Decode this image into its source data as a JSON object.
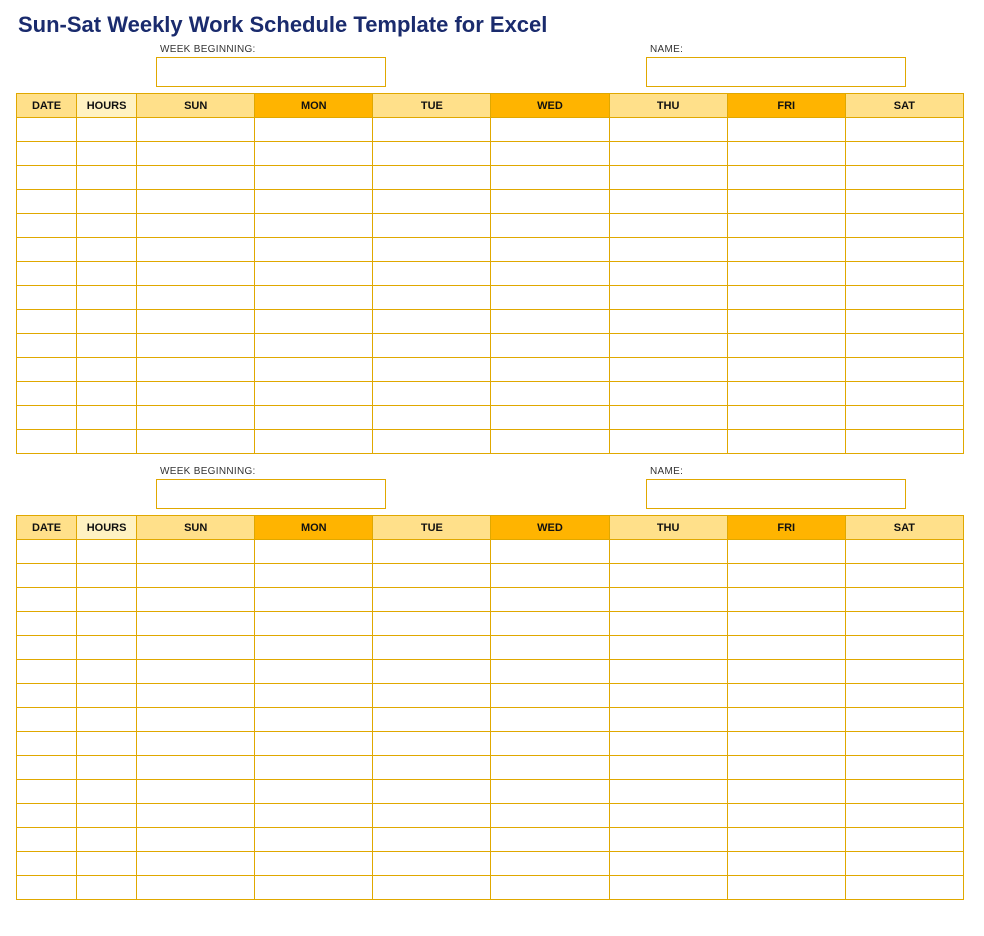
{
  "title": "Sun-Sat Weekly Work Schedule Template for Excel",
  "labels": {
    "week_beginning": "WEEK BEGINNING:",
    "name": "NAME:"
  },
  "columns": {
    "date": "DATE",
    "hours": "HOURS",
    "days": [
      "SUN",
      "MON",
      "TUE",
      "WED",
      "THU",
      "FRI",
      "SAT"
    ]
  },
  "day_shades": [
    "light",
    "bright",
    "light",
    "bright",
    "light",
    "bright",
    "light"
  ],
  "blocks": [
    {
      "week_beginning_value": "",
      "name_value": "",
      "row_count": 14
    },
    {
      "week_beginning_value": "",
      "name_value": "",
      "row_count": 15
    }
  ]
}
